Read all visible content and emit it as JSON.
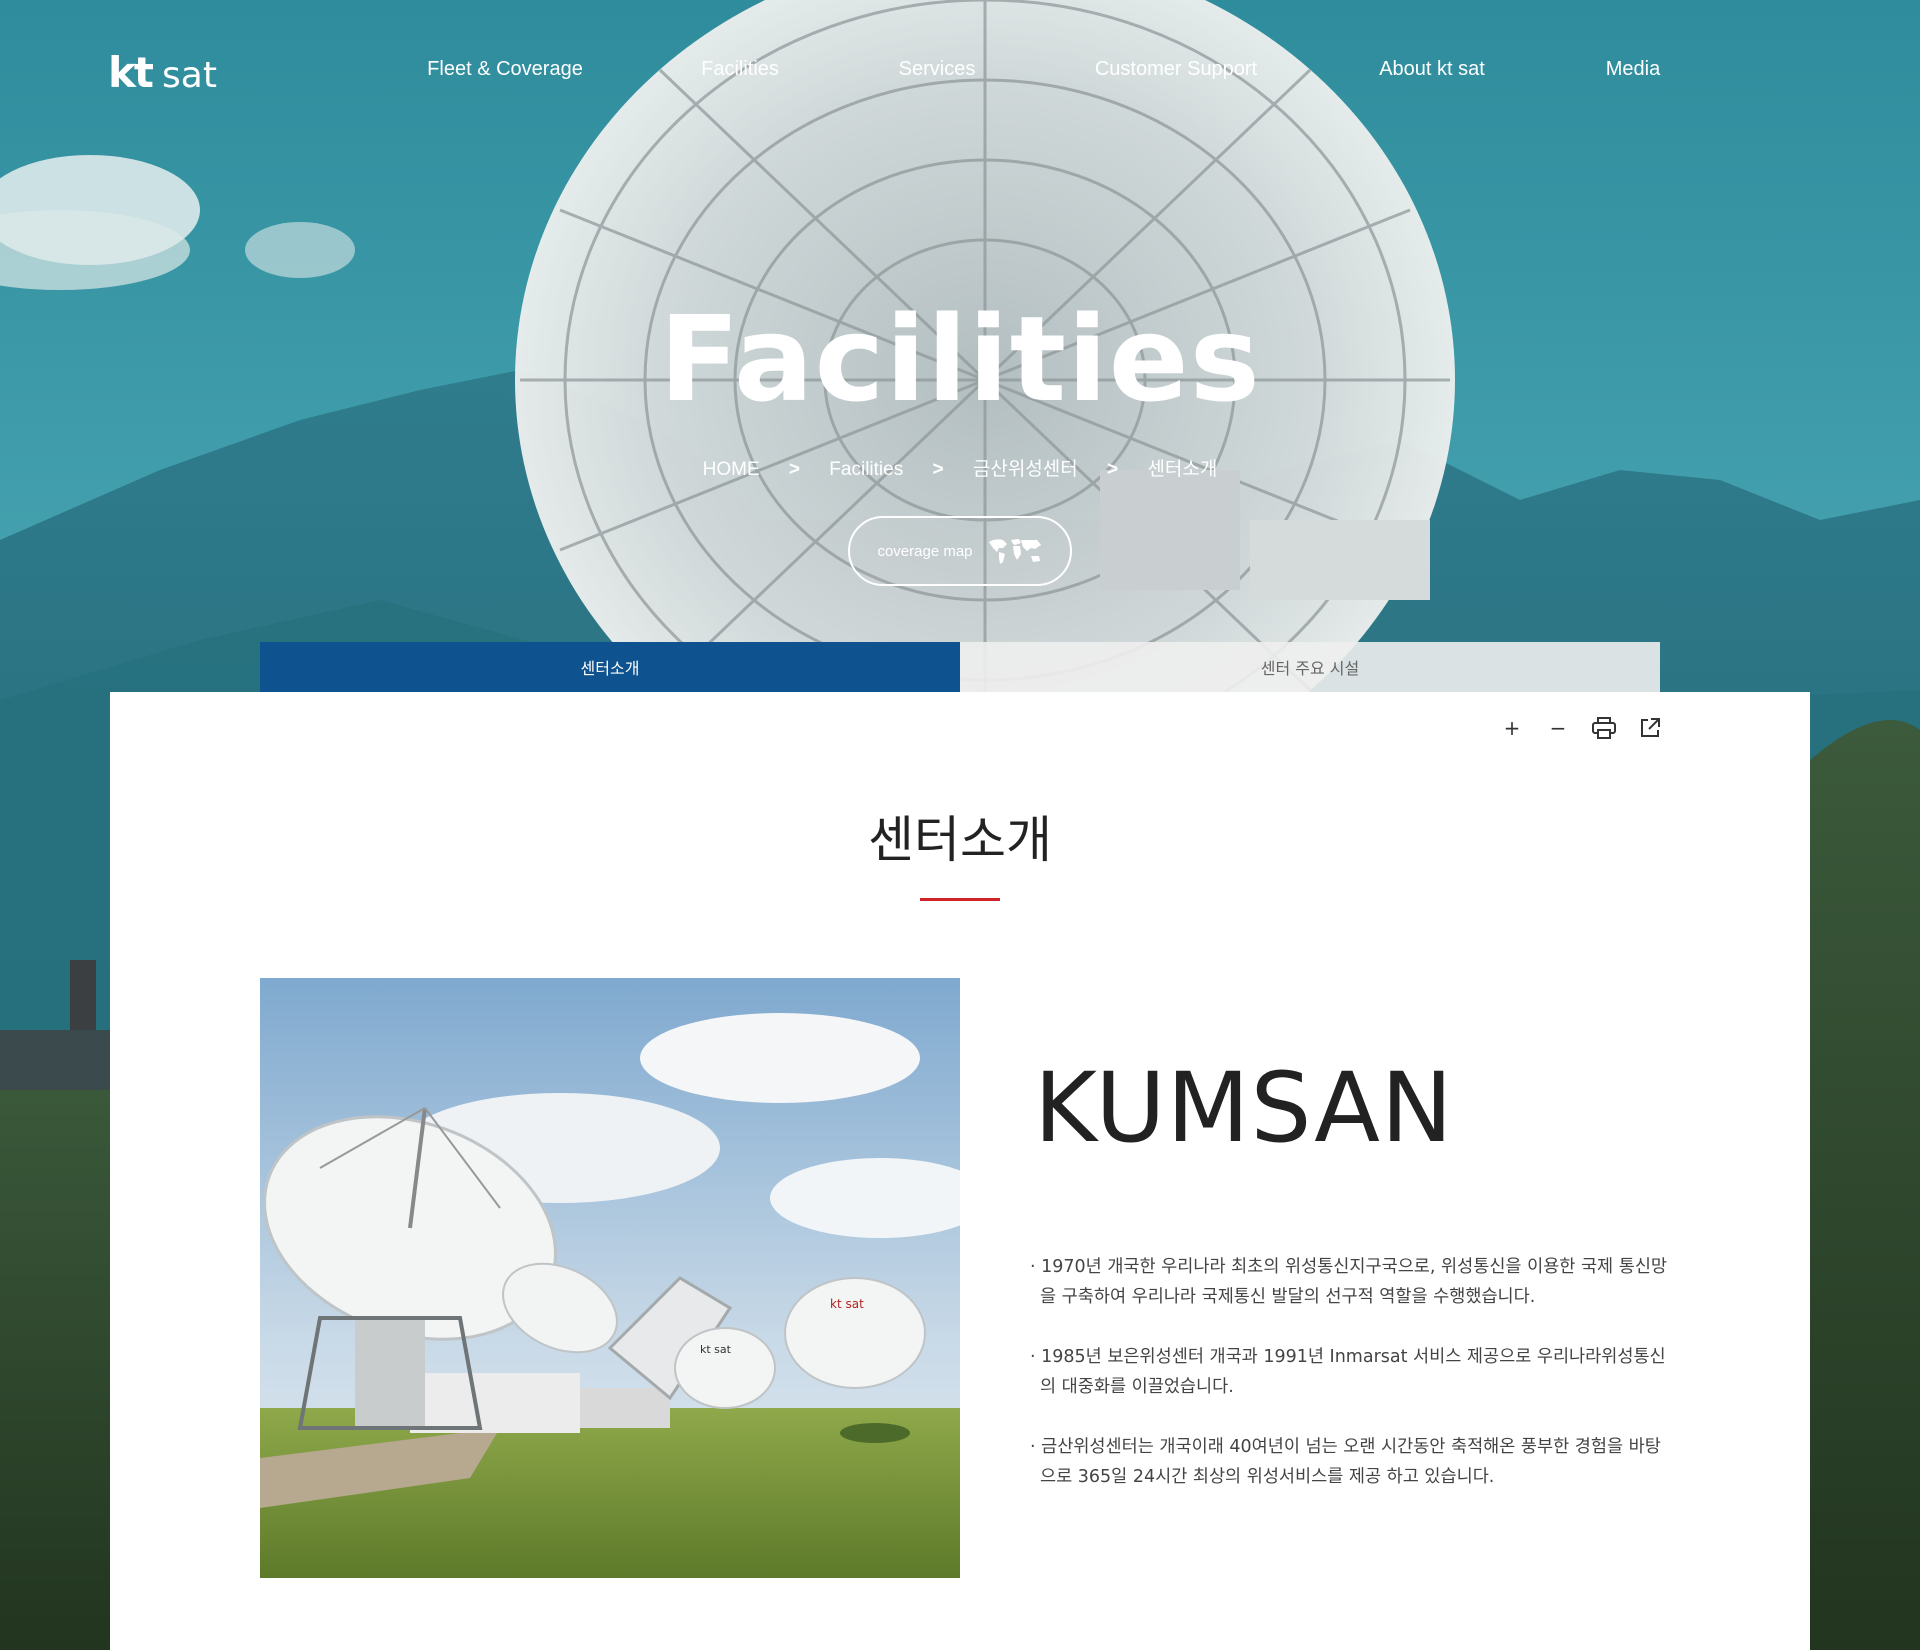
{
  "brand": {
    "kt": "kt",
    "sat": "sat"
  },
  "nav": [
    {
      "label": "Fleet & Coverage"
    },
    {
      "label": "Facilities"
    },
    {
      "label": "Services"
    },
    {
      "label": "Customer Support"
    },
    {
      "label": "About kt sat"
    },
    {
      "label": "Media"
    }
  ],
  "hero": {
    "title": "Facilities",
    "breadcrumb": [
      "HOME",
      "Facilities",
      "금산위성센터",
      "센터소개"
    ],
    "breadcrumb_separator": ">",
    "coverage_label": "coverage map"
  },
  "tabs": [
    {
      "label": "센터소개",
      "active": true
    },
    {
      "label": "센터 주요 시설",
      "active": false
    }
  ],
  "tools": {
    "zoom_in": "+",
    "zoom_out": "−",
    "print_icon": "print-icon",
    "share_icon": "external-link-icon"
  },
  "content": {
    "title": "센터소개",
    "heading": "KUMSAN",
    "bullets": [
      "· 1970년 개국한 우리나라 최초의 위성통신지구국으로, 위성통신을 이용한 국제 통신망을 구축하여 우리나라 국제통신 발달의 선구적 역할을 수행했습니다.",
      "· 1985년 보은위성센터 개국과 1991년 Inmarsat 서비스 제공으로 우리나라위성통신의 대중화를 이끌었습니다.",
      "· 금산위성센터는 개국이래 40여년이 넘는 오랜 시간동안 축적해온 풍부한 경험을 바탕으로 365일 24시간 최상의 위성서비스를 제공 하고 있습니다."
    ],
    "photo_brand": "kt sat"
  },
  "colors": {
    "accent_blue": "#0e528f",
    "accent_red": "#d1232a",
    "sky": "#3a9aa8"
  }
}
